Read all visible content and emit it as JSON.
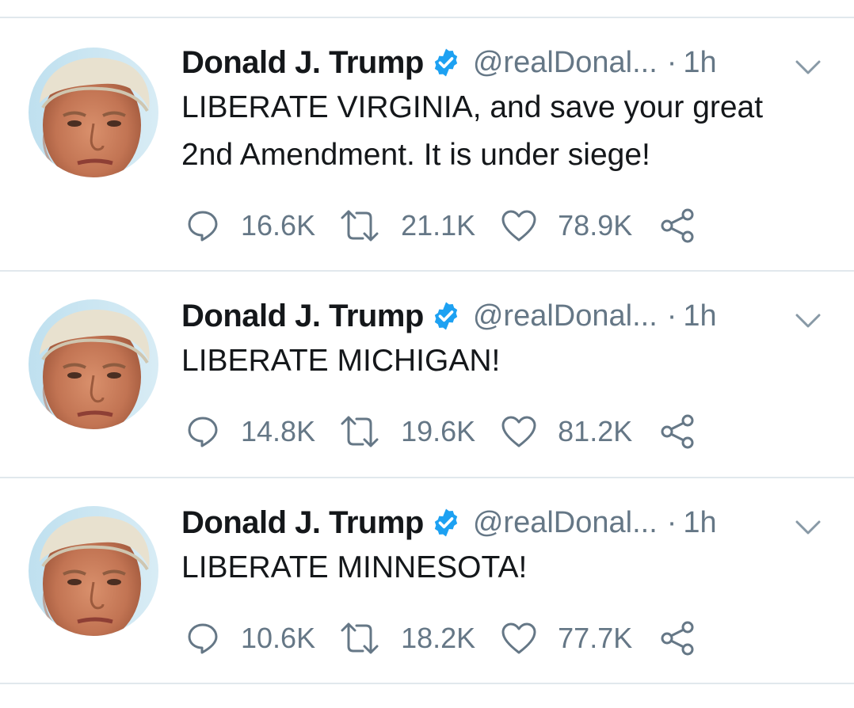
{
  "colors": {
    "text": "#14171a",
    "secondary": "#657786",
    "verified": "#1da1f2",
    "divider": "#e1e8ed"
  },
  "tweets": [
    {
      "name": "Donald J. Trump",
      "handle": "@realDonal...",
      "separator": "·",
      "time": "1h",
      "text_lines": [
        "LIBERATE VIRGINIA, and save your great",
        "2nd Amendment. It is under siege!"
      ],
      "replies": "16.6K",
      "retweets": "21.1K",
      "likes": "78.9K",
      "icons": [
        "verified-badge-icon",
        "chevron-down-icon",
        "reply-icon",
        "retweet-icon",
        "like-icon",
        "share-icon"
      ]
    },
    {
      "name": "Donald J. Trump",
      "handle": "@realDonal...",
      "separator": "·",
      "time": "1h",
      "text_lines": [
        "LIBERATE MICHIGAN!"
      ],
      "replies": "14.8K",
      "retweets": "19.6K",
      "likes": "81.2K",
      "icons": [
        "verified-badge-icon",
        "chevron-down-icon",
        "reply-icon",
        "retweet-icon",
        "like-icon",
        "share-icon"
      ]
    },
    {
      "name": "Donald J. Trump",
      "handle": "@realDonal...",
      "separator": "·",
      "time": "1h",
      "text_lines": [
        "LIBERATE MINNESOTA!"
      ],
      "replies": "10.6K",
      "retweets": "18.2K",
      "likes": "77.7K",
      "icons": [
        "verified-badge-icon",
        "chevron-down-icon",
        "reply-icon",
        "retweet-icon",
        "like-icon",
        "share-icon"
      ]
    }
  ]
}
